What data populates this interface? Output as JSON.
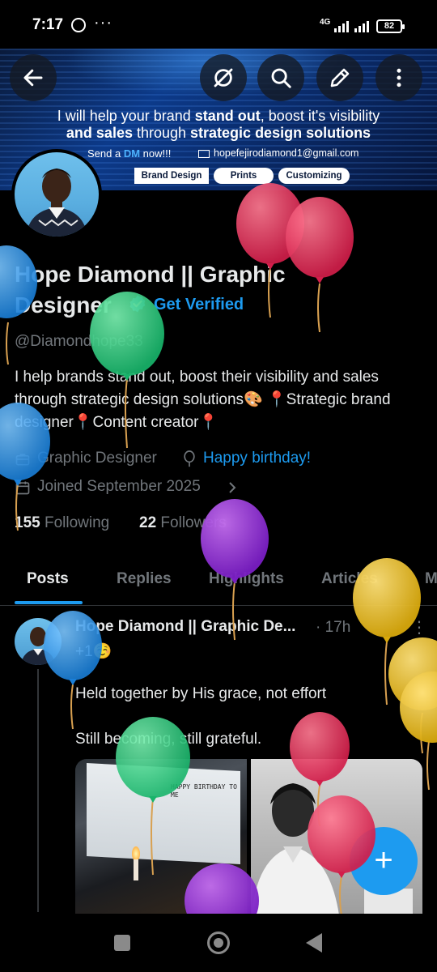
{
  "status_bar": {
    "time": "7:17",
    "dots": "···",
    "network": "4G",
    "battery": "82"
  },
  "banner": {
    "line1_a": "I will help your brand ",
    "line1_b": "stand out",
    "line1_c": ", boost it's visibility",
    "line2_a": "and sales",
    "line2_b": " through ",
    "line2_c": "strategic design solutions",
    "dm_a": "Send a ",
    "dm_b": "DM",
    "dm_c": " now!!!",
    "email": "hopefejirodiamond1@gmail.com",
    "tags": [
      "Brand Design",
      "Prints",
      "Customizing"
    ]
  },
  "profile": {
    "name": "Hope Diamond || Graphic Designer",
    "get_verified": "Get Verified",
    "handle": "@Diamondhope33",
    "bio": "I help brands stand out, boost their visibility and sales through strategic design solutions🎨 📍Strategic brand designer📍Content creator📍",
    "profession": "Graphic Designer",
    "birthday": "Happy birthday!",
    "joined": "Joined September 2025",
    "following_count": "155",
    "following_label": "Following",
    "followers_count": "22",
    "followers_label": "Followers"
  },
  "tabs": [
    "Posts",
    "Replies",
    "Highlights",
    "Articles",
    "M"
  ],
  "post": {
    "author": "Hope Diamond || Graphic De...",
    "time": "· 17h",
    "more": "⋮",
    "line1": "+1☺️",
    "line2": "Held together by His grace, not effort",
    "line3": "Still becoming, still grateful.",
    "image_text": "HAPPY BIRTHDAY TO ME"
  },
  "fab": {
    "label": "+"
  },
  "icons": {
    "back": "arrow-left-icon",
    "hide": "eye-slash-icon",
    "search": "search-icon",
    "edit": "pencil-icon",
    "more": "more-vertical-icon",
    "verified": "verified-badge-icon",
    "briefcase": "briefcase-icon",
    "balloon": "balloon-icon",
    "calendar": "calendar-icon",
    "chevron": "chevron-right-icon"
  },
  "colors": {
    "accent": "#1d9bf0",
    "text": "#e7e9ea",
    "muted": "#71767b",
    "background": "#000000"
  }
}
